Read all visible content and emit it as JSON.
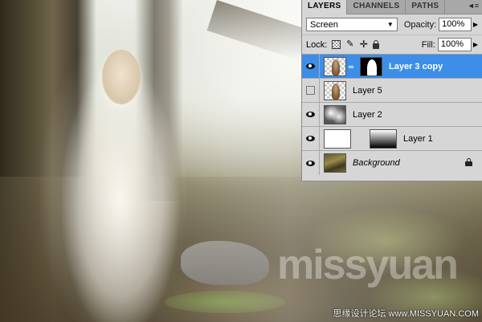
{
  "canvas": {
    "watermark_small": "思缘设计论坛 www.MISSYUAN.COM"
  },
  "layers_panel": {
    "tabs": [
      {
        "label": "LAYERS",
        "active": true
      },
      {
        "label": "CHANNELS",
        "active": false
      },
      {
        "label": "PATHS",
        "active": false
      }
    ],
    "blend_mode": "Screen",
    "opacity_label": "Opacity:",
    "opacity_value": "100%",
    "lock_label": "Lock:",
    "fill_label": "Fill:",
    "fill_value": "100%",
    "layers": [
      {
        "name": "Layer 3 copy",
        "visible": true,
        "selected": true,
        "thumbnail": "figure-on-transparent",
        "mask": "figure-silhouette-mask"
      },
      {
        "name": "Layer 5",
        "visible": false,
        "selected": false,
        "thumbnail": "figure-on-transparent"
      },
      {
        "name": "Layer 2",
        "visible": true,
        "selected": false,
        "thumbnail": "clouds"
      },
      {
        "name": "Layer 1",
        "visible": true,
        "selected": false,
        "thumbnail": "white",
        "mask": "gradient-mask"
      },
      {
        "name": "Background",
        "visible": true,
        "selected": false,
        "thumbnail": "forest",
        "locked": true
      }
    ]
  },
  "colors": {
    "selection_blue": "#3d8ee8",
    "panel_gray": "#d6d6d6"
  }
}
